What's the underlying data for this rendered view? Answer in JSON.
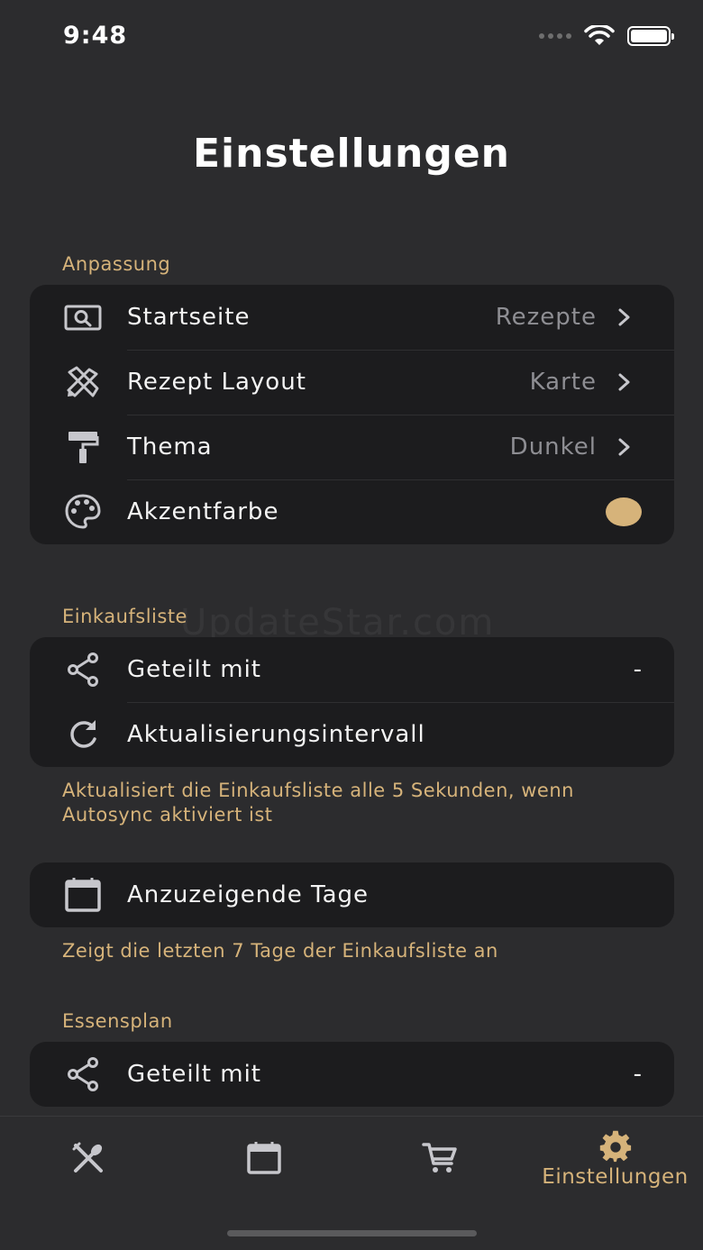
{
  "status_bar": {
    "time": "9:48"
  },
  "page_title": "Einstellungen",
  "watermark": "UpdateStar.com",
  "sections": {
    "anpassung": {
      "label": "Anpassung",
      "rows": [
        {
          "label": "Startseite",
          "value": "Rezepte",
          "icon": "search-screen-icon"
        },
        {
          "label": "Rezept Layout",
          "value": "Karte",
          "icon": "tools-icon"
        },
        {
          "label": "Thema",
          "value": "Dunkel",
          "icon": "paint-roller-icon"
        },
        {
          "label": "Akzentfarbe",
          "value": "",
          "icon": "palette-icon",
          "accent_color": "#d6b37a"
        }
      ]
    },
    "einkaufsliste": {
      "label": "Einkaufsliste",
      "rows": [
        {
          "label": "Geteilt mit",
          "value": "-",
          "icon": "share-icon"
        },
        {
          "label": "Aktualisierungsintervall",
          "value": "",
          "icon": "refresh-icon"
        }
      ],
      "footnote": "Aktualisiert die Einkaufsliste alle 5 Sekunden, wenn Autosync aktiviert ist"
    },
    "tage": {
      "rows": [
        {
          "label": "Anzuzeigende Tage",
          "icon": "calendar-icon"
        }
      ],
      "footnote": "Zeigt die letzten 7 Tage der Einkaufsliste an"
    },
    "essensplan": {
      "label": "Essensplan",
      "rows": [
        {
          "label": "Geteilt mit",
          "value": "-",
          "icon": "share-icon"
        }
      ]
    }
  },
  "tab_bar": {
    "tabs": [
      {
        "name": "recipes",
        "icon": "utensils-icon",
        "label": ""
      },
      {
        "name": "meal-plan",
        "icon": "calendar-icon",
        "label": ""
      },
      {
        "name": "shopping",
        "icon": "cart-icon",
        "label": ""
      },
      {
        "name": "settings",
        "icon": "gear-icon",
        "label": "Einstellungen",
        "active": true
      }
    ]
  },
  "colors": {
    "accent": "#d6b37a",
    "background": "#2c2c2e",
    "card": "#1c1c1e"
  }
}
